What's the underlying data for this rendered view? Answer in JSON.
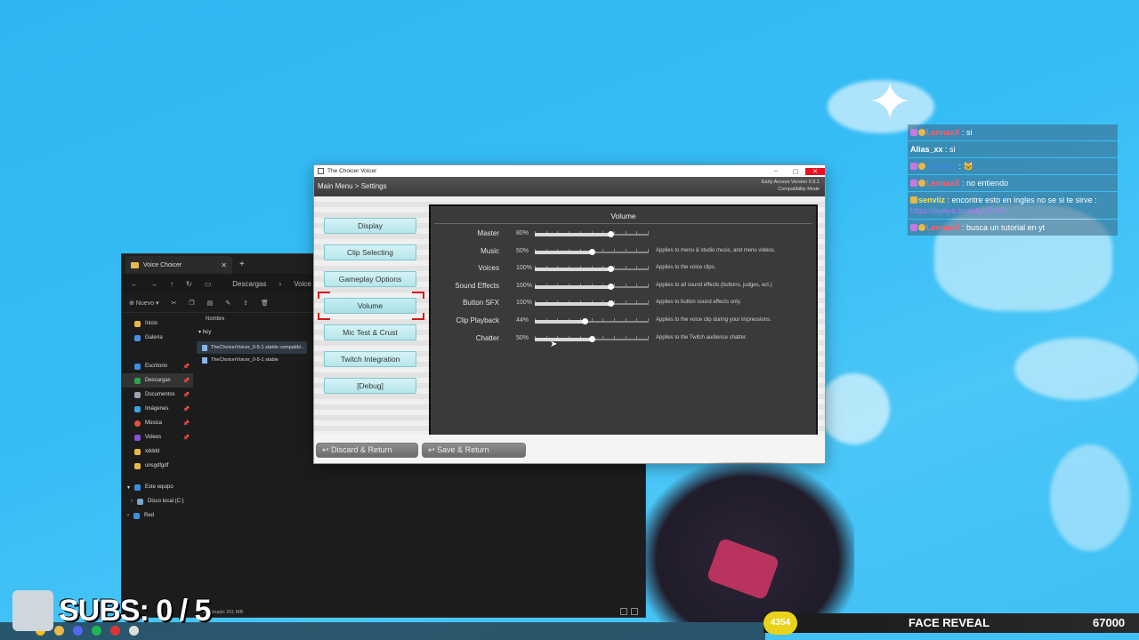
{
  "game": {
    "title": "The Choicer Voicer",
    "breadcrumb": "Main Menu > Settings",
    "version": "Early Access Version 0.5.1",
    "mode": "Compatibility Mode",
    "menu": [
      "Display",
      "Clip Selecting",
      "Gameplay Options",
      "Volume",
      "Mic Test & Crust",
      "Twitch Integration",
      "[Debug]"
    ],
    "active_menu": "Volume",
    "panel_title": "Volume",
    "volume": [
      {
        "label": "Master",
        "value": "80%",
        "level": 0.8,
        "desc": ""
      },
      {
        "label": "Music",
        "value": "50%",
        "level": 0.5,
        "desc": "Applies to menu & studio music, and menu videos."
      },
      {
        "label": "Voices",
        "value": "100%",
        "level": 1.0,
        "desc": "Applies to the voice clips."
      },
      {
        "label": "Sound Effects",
        "value": "100%",
        "level": 1.0,
        "desc": "Applies to all sound effects (buttons, judges, ect.)"
      },
      {
        "label": "Button SFX",
        "value": "100%",
        "level": 1.0,
        "desc": "Applies to button sound effects only."
      },
      {
        "label": "Clip Playback",
        "value": "44%",
        "level": 0.44,
        "desc": "Applies to the voice clip during your impressions."
      },
      {
        "label": "Chatter",
        "value": "50%",
        "level": 0.5,
        "desc": "Applies to the Twitch audience chatter."
      }
    ],
    "discard_label": "Discard & Return",
    "save_label": "Save & Return"
  },
  "explorer": {
    "tab_title": "Voice Choicer",
    "crumbs": [
      "Descargas",
      "Voice Ch..."
    ],
    "new_label": "Nuevo",
    "column_name": "Nombre",
    "group": "hoy",
    "files": [
      "TheChoicerVoicer_0-5-1 stable compatibi...",
      "TheChoicerVoicer_0-5-1 stable"
    ],
    "sidebar": [
      "Inicio",
      "Galería",
      "Escritorio",
      "Descargas",
      "Documentos",
      "Imágenes",
      "Música",
      "Videos",
      "xdddd",
      "unsgdfgdf",
      "Este equipo",
      "Disco local (C:)",
      "Red"
    ],
    "status": "...eccionado 201 MB"
  },
  "chat": [
    {
      "user": "LennaaX",
      "text": ": si"
    },
    {
      "user": "Alias_xx",
      "text": ": si"
    },
    {
      "user": "xenomy",
      "text": ": 🐱"
    },
    {
      "user": "LennaaX",
      "text": ": no entiendo"
    },
    {
      "user": "senviiz",
      "text": ": encontre esto en ingles no se si te sirve : ",
      "link": "https://ayaya.beauty/CbA2n"
    },
    {
      "user": "LennaaX",
      "text": ": busca un tutorial en yt"
    }
  ],
  "overlay": {
    "subs": "SUBS: 0 / 5",
    "goal_current": "4354",
    "goal_label": "FACE REVEAL",
    "goal_target": "67000"
  },
  "colors": {
    "menu_button": "#b7e6ea",
    "selection_frame": "#d41818",
    "panel_bg": "#3a3a3a",
    "background": "#36bdf5"
  }
}
